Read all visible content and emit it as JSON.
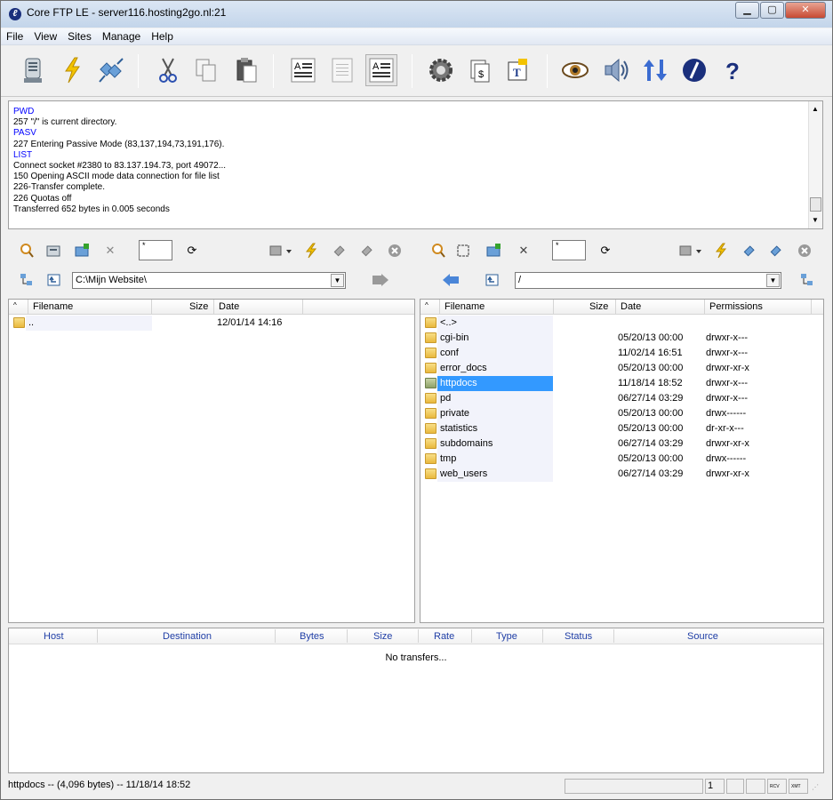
{
  "window": {
    "title": "Core FTP LE - server116.hosting2go.nl:21",
    "min": "▁",
    "max": "▢",
    "close": "✕"
  },
  "menu": [
    "File",
    "View",
    "Sites",
    "Manage",
    "Help"
  ],
  "log": [
    "PWD",
    "257 \"/\" is current directory.",
    "PASV",
    "227 Entering Passive Mode (83,137,194,73,191,176).",
    "LIST",
    "Connect socket #2380 to 83.137.194.73, port 49072...",
    "150 Opening ASCII mode data connection for file list",
    "226-Transfer complete.",
    "226 Quotas off",
    "Transferred 652 bytes in 0.005 seconds"
  ],
  "log_colors": {
    "command": "#0000ff",
    "response": "#000000"
  },
  "left": {
    "filter": "*",
    "path": "C:\\Mijn Website\\",
    "columns": {
      "name": "Filename",
      "size": "Size",
      "date": "Date"
    },
    "rows": [
      {
        "name": "..",
        "size": "",
        "date": "12/01/14  14:16"
      }
    ]
  },
  "right": {
    "filter": "*",
    "path": "/",
    "columns": {
      "name": "Filename",
      "size": "Size",
      "date": "Date",
      "perm": "Permissions"
    },
    "rows": [
      {
        "name": "<..>",
        "date": "",
        "perm": ""
      },
      {
        "name": "cgi-bin",
        "date": "05/20/13  00:00",
        "perm": "drwxr-x---"
      },
      {
        "name": "conf",
        "date": "11/02/14  16:51",
        "perm": "drwxr-x---"
      },
      {
        "name": "error_docs",
        "date": "05/20/13  00:00",
        "perm": "drwxr-xr-x"
      },
      {
        "name": "httpdocs",
        "date": "11/18/14  18:52",
        "perm": "drwxr-x---",
        "selected": true
      },
      {
        "name": "pd",
        "date": "06/27/14  03:29",
        "perm": "drwxr-x---"
      },
      {
        "name": "private",
        "date": "05/20/13  00:00",
        "perm": "drwx------"
      },
      {
        "name": "statistics",
        "date": "05/20/13  00:00",
        "perm": "dr-xr-x---"
      },
      {
        "name": "subdomains",
        "date": "06/27/14  03:29",
        "perm": "drwxr-xr-x"
      },
      {
        "name": "tmp",
        "date": "05/20/13  00:00",
        "perm": "drwx------"
      },
      {
        "name": "web_users",
        "date": "06/27/14  03:29",
        "perm": "drwxr-xr-x"
      }
    ]
  },
  "queue": {
    "columns": [
      "Host",
      "Destination",
      "Bytes",
      "Size",
      "Rate",
      "Type",
      "Status",
      "Source"
    ],
    "empty": "No transfers..."
  },
  "status": {
    "text": "httpdocs -- (4,096 bytes) -- 11/18/14  18:52",
    "count": "1",
    "rcv": "RCV",
    "xmt": "XMT"
  },
  "toolbar_icons": [
    "site-manager-icon",
    "quick-connect-icon",
    "disconnect-icon",
    "cut-icon",
    "copy-icon",
    "paste-icon",
    "ascii-mode-icon",
    "binary-mode-icon",
    "auto-mode-icon",
    "settings-icon",
    "cost-icon",
    "text-icon",
    "view-icon",
    "sound-icon",
    "sync-icon",
    "about-icon",
    "help-icon"
  ]
}
